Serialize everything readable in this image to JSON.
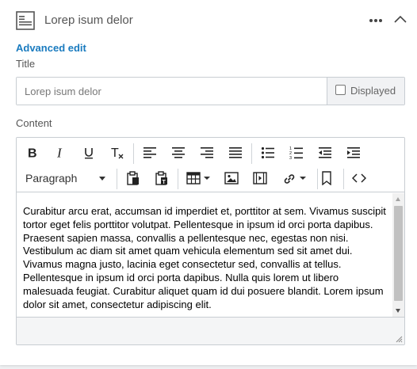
{
  "header": {
    "title": "Lorep isum delor",
    "icons": {
      "doc": "document-icon",
      "more": "more-horizontal-icon",
      "collapse": "chevron-up-icon"
    }
  },
  "advanced_edit": "Advanced edit",
  "title_field": {
    "label": "Title",
    "placeholder": "Lorep isum delor",
    "value": "",
    "displayed_label": "Displayed",
    "displayed_checked": false
  },
  "content_field": {
    "label": "Content",
    "format_select": "Paragraph",
    "toolbar": {
      "row1": [
        "bold-icon",
        "italic-icon",
        "underline-icon",
        "clear-formatting-icon",
        "align-left-icon",
        "align-center-icon",
        "align-right-icon",
        "align-justify-icon",
        "bullet-list-icon",
        "numbered-list-icon",
        "outdent-icon",
        "indent-icon"
      ],
      "row2": [
        "paste-icon",
        "paste-text-icon",
        "table-icon",
        "image-icon",
        "media-icon",
        "link-icon",
        "bookmark-icon",
        "source-code-icon"
      ]
    },
    "text": "Curabitur arcu erat, accumsan id imperdiet et, porttitor at sem. Vivamus suscipit tortor eget felis porttitor volutpat. Pellentesque in ipsum id orci porta dapibus. Praesent sapien massa, convallis a pellentesque nec, egestas non nisi. Vestibulum ac diam sit amet quam vehicula elementum sed sit amet dui. Vivamus magna justo, lacinia eget consectetur sed, convallis at tellus. Pellentesque in ipsum id orci porta dapibus. Nulla quis lorem ut libero malesuada feugiat. Curabitur aliquet quam id dui posuere blandit. Lorem ipsum dolor sit amet, consectetur adipiscing elit."
  },
  "colors": {
    "accent": "#1a7bbf",
    "border": "#c8cdd2",
    "addon_bg": "#f1f2f4"
  }
}
